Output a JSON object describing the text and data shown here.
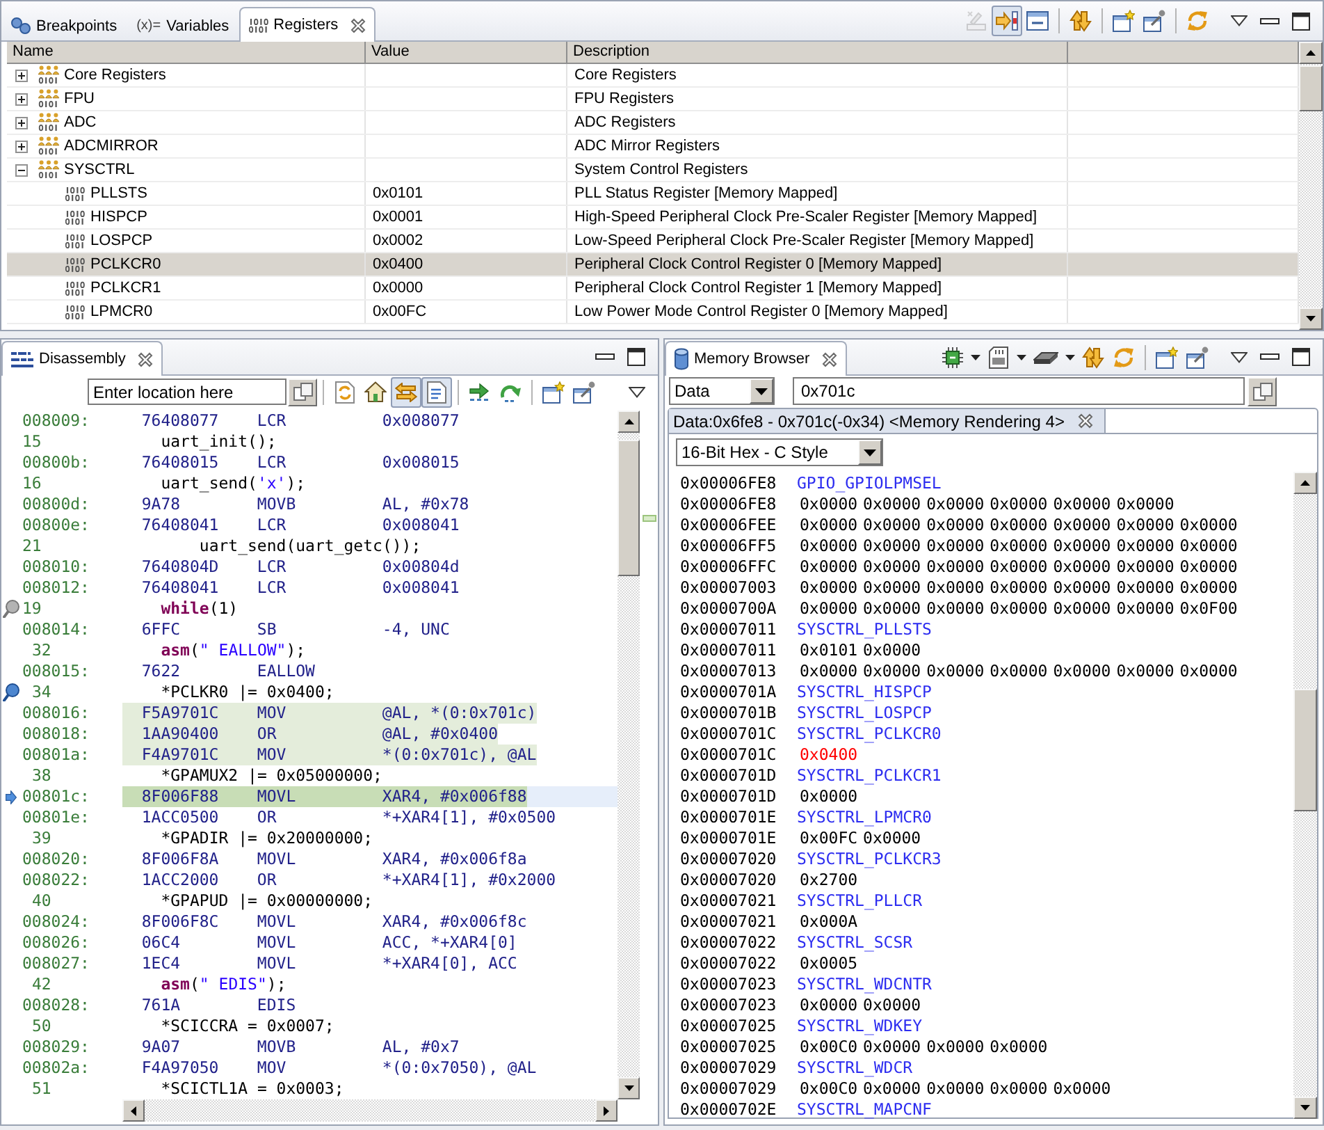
{
  "registers_view": {
    "tabs": [
      {
        "label": "Breakpoints",
        "selected": false
      },
      {
        "label": "Variables",
        "glyph": "(x)=",
        "selected": false
      },
      {
        "label": "Registers",
        "selected": true
      }
    ],
    "toolbar": [
      {
        "pressed": false,
        "disabled": true
      },
      {
        "pressed": true,
        "disabled": false
      },
      {
        "pressed": false,
        "disabled": false
      },
      {
        "pressed": false,
        "disabled": false
      },
      {
        "pressed": false,
        "disabled": false
      },
      {
        "pressed": false,
        "disabled": false
      },
      {
        "pressed": false,
        "disabled": false
      }
    ],
    "table": {
      "columns": [
        "Name",
        "Value",
        "Description"
      ],
      "rows": [
        {
          "kind": "group",
          "name": "Core Registers",
          "description": "Core Registers",
          "expanded": false,
          "selected": false
        },
        {
          "kind": "group",
          "name": "FPU",
          "description": "FPU Registers",
          "expanded": false,
          "selected": false
        },
        {
          "kind": "group",
          "name": "ADC",
          "description": "ADC Registers",
          "expanded": false,
          "selected": false
        },
        {
          "kind": "group",
          "name": "ADCMIRROR",
          "description": "ADC Mirror Registers",
          "expanded": false,
          "selected": false
        },
        {
          "kind": "group",
          "name": "SYSCTRL",
          "description": "System Control Registers",
          "expanded": true,
          "selected": false,
          "children": [
            {
              "kind": "register",
              "name": "PLLSTS",
              "value": "0x0101",
              "description": "PLL Status Register [Memory Mapped]",
              "selected": false
            },
            {
              "kind": "register",
              "name": "HISPCP",
              "value": "0x0001",
              "description": "High-Speed Peripheral Clock Pre-Scaler Register [Memory Mapped]",
              "selected": false
            },
            {
              "kind": "register",
              "name": "LOSPCP",
              "value": "0x0002",
              "description": "Low-Speed Peripheral Clock Pre-Scaler Register [Memory Mapped]",
              "selected": false
            },
            {
              "kind": "register",
              "name": "PCLKCR0",
              "value": "0x0400",
              "description": "Peripheral Clock Control Register 0 [Memory Mapped]",
              "selected": true
            },
            {
              "kind": "register",
              "name": "PCLKCR1",
              "value": "0x0000",
              "description": "Peripheral Clock Control Register 1 [Memory Mapped]",
              "selected": false
            },
            {
              "kind": "register",
              "name": "LPMCR0",
              "value": "0x00FC",
              "description": "Low Power Mode Control Register 0 [Memory Mapped]",
              "selected": false
            }
          ]
        }
      ]
    }
  },
  "disassembly_view": {
    "tabs": [
      {
        "label": "Disassembly",
        "selected": true
      }
    ],
    "location": {
      "placeholder": "Enter location here"
    },
    "toolbar": [
      {
        "pressed": false
      },
      {
        "pressed": false
      },
      {
        "pressed": true
      },
      {
        "pressed": true
      },
      {
        "pressed": false
      },
      {
        "pressed": false
      },
      {
        "pressed": false
      },
      {
        "pressed": false
      }
    ],
    "lines": [
      {
        "kind": "instruction",
        "address": "008009:",
        "opcode": "76408077",
        "mnemonic": "LCR",
        "operands": "0x008077",
        "highlighted": false,
        "current": false
      },
      {
        "kind": "source",
        "line": "15",
        "code": [
          {
            "kind": "plain",
            "text": "  uart_init();"
          }
        ],
        "breakpoint": false
      },
      {
        "kind": "instruction",
        "address": "00800b:",
        "opcode": "76408015",
        "mnemonic": "LCR",
        "operands": "0x008015",
        "highlighted": false,
        "current": false
      },
      {
        "kind": "source",
        "line": "16",
        "code": [
          {
            "kind": "plain",
            "text": "  uart_send("
          },
          {
            "kind": "string",
            "text": "'x'"
          },
          {
            "kind": "plain",
            "text": ");"
          }
        ],
        "breakpoint": false
      },
      {
        "kind": "instruction",
        "address": "00800d:",
        "opcode": "9A78",
        "mnemonic": "MOVB",
        "operands": "AL, #0x78",
        "highlighted": false,
        "current": false
      },
      {
        "kind": "instruction",
        "address": "00800e:",
        "opcode": "76408041",
        "mnemonic": "LCR",
        "operands": "0x008041",
        "highlighted": false,
        "current": false
      },
      {
        "kind": "source",
        "line": "21",
        "code": [
          {
            "kind": "plain",
            "text": "      uart_send(uart_getc());"
          }
        ],
        "breakpoint": false
      },
      {
        "kind": "instruction",
        "address": "008010:",
        "opcode": "7640804D",
        "mnemonic": "LCR",
        "operands": "0x00804d",
        "highlighted": false,
        "current": false
      },
      {
        "kind": "instruction",
        "address": "008012:",
        "opcode": "76408041",
        "mnemonic": "LCR",
        "operands": "0x008041",
        "highlighted": false,
        "current": false
      },
      {
        "kind": "source",
        "line": "19",
        "code": [
          {
            "kind": "keyword",
            "text": "  while"
          },
          {
            "kind": "plain",
            "text": "(1)"
          }
        ],
        "breakpoint": true,
        "breakpoint_enabled": false
      },
      {
        "kind": "instruction",
        "address": "008014:",
        "opcode": "6FFC",
        "mnemonic": "SB",
        "operands": "-4, UNC",
        "highlighted": false,
        "current": false
      },
      {
        "kind": "source",
        "line": " 32",
        "code": [
          {
            "kind": "keyword",
            "text": "  asm"
          },
          {
            "kind": "plain",
            "text": "("
          },
          {
            "kind": "string",
            "text": "\" EALLOW\""
          },
          {
            "kind": "plain",
            "text": ");"
          }
        ],
        "breakpoint": false
      },
      {
        "kind": "instruction",
        "address": "008015:",
        "opcode": "7622",
        "mnemonic": "EALLOW",
        "highlighted": false,
        "current": false
      },
      {
        "kind": "source",
        "line": " 34",
        "code": [
          {
            "kind": "plain",
            "text": "  *PCLKR0 |= 0x0400;"
          }
        ],
        "breakpoint": true,
        "breakpoint_enabled": true
      },
      {
        "kind": "instruction",
        "address": "008016:",
        "opcode": "F5A9701C",
        "mnemonic": "MOV",
        "operands": "@AL, *(0:0x701c)",
        "highlighted": true,
        "current": false
      },
      {
        "kind": "instruction",
        "address": "008018:",
        "opcode": "1AA90400",
        "mnemonic": "OR",
        "operands": "@AL, #0x0400",
        "highlighted": true,
        "current": false
      },
      {
        "kind": "instruction",
        "address": "00801a:",
        "opcode": "F4A9701C",
        "mnemonic": "MOV",
        "operands": "*(0:0x701c), @AL",
        "highlighted": true,
        "current": false
      },
      {
        "kind": "source",
        "line": " 38",
        "code": [
          {
            "kind": "plain",
            "text": "  *GPAMUX2 |= 0x05000000;"
          }
        ],
        "breakpoint": false
      },
      {
        "kind": "instruction",
        "address": "00801c:",
        "opcode": "8F006F88",
        "mnemonic": "MOVL",
        "operands": "XAR4, #0x006f88",
        "highlighted": true,
        "current": true
      },
      {
        "kind": "instruction",
        "address": "00801e:",
        "opcode": "1ACC0500",
        "mnemonic": "OR",
        "operands": "*+XAR4[1], #0x0500",
        "highlighted": false,
        "current": false
      },
      {
        "kind": "source",
        "line": " 39",
        "code": [
          {
            "kind": "plain",
            "text": "  *GPADIR |= 0x20000000;"
          }
        ],
        "breakpoint": false
      },
      {
        "kind": "instruction",
        "address": "008020:",
        "opcode": "8F006F8A",
        "mnemonic": "MOVL",
        "operands": "XAR4, #0x006f8a",
        "highlighted": false,
        "current": false
      },
      {
        "kind": "instruction",
        "address": "008022:",
        "opcode": "1ACC2000",
        "mnemonic": "OR",
        "operands": "*+XAR4[1], #0x2000",
        "highlighted": false,
        "current": false
      },
      {
        "kind": "source",
        "line": " 40",
        "code": [
          {
            "kind": "plain",
            "text": "  *GPAPUD |= 0x00000000;"
          }
        ],
        "breakpoint": false
      },
      {
        "kind": "instruction",
        "address": "008024:",
        "opcode": "8F006F8C",
        "mnemonic": "MOVL",
        "operands": "XAR4, #0x006f8c",
        "highlighted": false,
        "current": false
      },
      {
        "kind": "instruction",
        "address": "008026:",
        "opcode": "06C4",
        "mnemonic": "MOVL",
        "operands": "ACC, *+XAR4[0]",
        "highlighted": false,
        "current": false
      },
      {
        "kind": "instruction",
        "address": "008027:",
        "opcode": "1EC4",
        "mnemonic": "MOVL",
        "operands": "*+XAR4[0], ACC",
        "highlighted": false,
        "current": false
      },
      {
        "kind": "source",
        "line": " 42",
        "code": [
          {
            "kind": "keyword",
            "text": "  asm"
          },
          {
            "kind": "plain",
            "text": "("
          },
          {
            "kind": "string",
            "text": "\" EDIS\""
          },
          {
            "kind": "plain",
            "text": ");"
          }
        ],
        "breakpoint": false
      },
      {
        "kind": "instruction",
        "address": "008028:",
        "opcode": "761A",
        "mnemonic": "EDIS",
        "highlighted": false,
        "current": false
      },
      {
        "kind": "source",
        "line": " 50",
        "code": [
          {
            "kind": "plain",
            "text": "  *SCICCRA = 0x0007;"
          }
        ],
        "breakpoint": false
      },
      {
        "kind": "instruction",
        "address": "008029:",
        "opcode": "9A07",
        "mnemonic": "MOVB",
        "operands": "AL, #0x7",
        "highlighted": false,
        "current": false
      },
      {
        "kind": "instruction",
        "address": "00802a:",
        "opcode": "F4A97050",
        "mnemonic": "MOV",
        "operands": "*(0:0x7050), @AL",
        "highlighted": false,
        "current": false
      },
      {
        "kind": "source",
        "line": " 51",
        "code": [
          {
            "kind": "plain",
            "text": "  *SCICTL1A = 0x0003;"
          }
        ],
        "breakpoint": false
      }
    ]
  },
  "memory_view": {
    "tabs": [
      {
        "label": "Memory Browser",
        "selected": true
      }
    ],
    "memory_space": {
      "value": "Data"
    },
    "address": {
      "value": "0x701c"
    },
    "rendering_tabs": [
      {
        "label": "Data:0x6fe8 - 0x701c(-0x34) <Memory Rendering 4>",
        "selected": true
      }
    ],
    "format": {
      "value": "16-Bit Hex - C Style"
    },
    "lines": [
      {
        "kind": "label",
        "address": "0x00006FE8",
        "label": "GPIO_GPIOLPMSEL"
      },
      {
        "kind": "data",
        "address": "0x00006FE8",
        "values": [
          {
            "text": "0x0000",
            "changed": false
          },
          {
            "text": "0x0000",
            "changed": false
          },
          {
            "text": "0x0000",
            "changed": false
          },
          {
            "text": "0x0000",
            "changed": false
          },
          {
            "text": "0x0000",
            "changed": false
          },
          {
            "text": "0x0000",
            "changed": false
          }
        ]
      },
      {
        "kind": "data",
        "address": "0x00006FEE",
        "values": [
          {
            "text": "0x0000",
            "changed": false
          },
          {
            "text": "0x0000",
            "changed": false
          },
          {
            "text": "0x0000",
            "changed": false
          },
          {
            "text": "0x0000",
            "changed": false
          },
          {
            "text": "0x0000",
            "changed": false
          },
          {
            "text": "0x0000",
            "changed": false
          },
          {
            "text": "0x0000",
            "changed": false
          }
        ]
      },
      {
        "kind": "data",
        "address": "0x00006FF5",
        "values": [
          {
            "text": "0x0000",
            "changed": false
          },
          {
            "text": "0x0000",
            "changed": false
          },
          {
            "text": "0x0000",
            "changed": false
          },
          {
            "text": "0x0000",
            "changed": false
          },
          {
            "text": "0x0000",
            "changed": false
          },
          {
            "text": "0x0000",
            "changed": false
          },
          {
            "text": "0x0000",
            "changed": false
          }
        ]
      },
      {
        "kind": "data",
        "address": "0x00006FFC",
        "values": [
          {
            "text": "0x0000",
            "changed": false
          },
          {
            "text": "0x0000",
            "changed": false
          },
          {
            "text": "0x0000",
            "changed": false
          },
          {
            "text": "0x0000",
            "changed": false
          },
          {
            "text": "0x0000",
            "changed": false
          },
          {
            "text": "0x0000",
            "changed": false
          },
          {
            "text": "0x0000",
            "changed": false
          }
        ]
      },
      {
        "kind": "data",
        "address": "0x00007003",
        "values": [
          {
            "text": "0x0000",
            "changed": false
          },
          {
            "text": "0x0000",
            "changed": false
          },
          {
            "text": "0x0000",
            "changed": false
          },
          {
            "text": "0x0000",
            "changed": false
          },
          {
            "text": "0x0000",
            "changed": false
          },
          {
            "text": "0x0000",
            "changed": false
          },
          {
            "text": "0x0000",
            "changed": false
          }
        ]
      },
      {
        "kind": "data",
        "address": "0x0000700A",
        "values": [
          {
            "text": "0x0000",
            "changed": false
          },
          {
            "text": "0x0000",
            "changed": false
          },
          {
            "text": "0x0000",
            "changed": false
          },
          {
            "text": "0x0000",
            "changed": false
          },
          {
            "text": "0x0000",
            "changed": false
          },
          {
            "text": "0x0000",
            "changed": false
          },
          {
            "text": "0x0F00",
            "changed": false
          }
        ]
      },
      {
        "kind": "label",
        "address": "0x00007011",
        "label": "SYSCTRL_PLLSTS"
      },
      {
        "kind": "data",
        "address": "0x00007011",
        "values": [
          {
            "text": "0x0101",
            "changed": false
          },
          {
            "text": "0x0000",
            "changed": false
          }
        ]
      },
      {
        "kind": "data",
        "address": "0x00007013",
        "values": [
          {
            "text": "0x0000",
            "changed": false
          },
          {
            "text": "0x0000",
            "changed": false
          },
          {
            "text": "0x0000",
            "changed": false
          },
          {
            "text": "0x0000",
            "changed": false
          },
          {
            "text": "0x0000",
            "changed": false
          },
          {
            "text": "0x0000",
            "changed": false
          },
          {
            "text": "0x0000",
            "changed": false
          }
        ]
      },
      {
        "kind": "label",
        "address": "0x0000701A",
        "label": "SYSCTRL_HISPCP"
      },
      {
        "kind": "label",
        "address": "0x0000701B",
        "label": "SYSCTRL_LOSPCP"
      },
      {
        "kind": "label",
        "address": "0x0000701C",
        "label": "SYSCTRL_PCLKCR0"
      },
      {
        "kind": "data",
        "address": "0x0000701C",
        "values": [
          {
            "text": "0x0400",
            "changed": true
          }
        ]
      },
      {
        "kind": "label",
        "address": "0x0000701D",
        "label": "SYSCTRL_PCLKCR1"
      },
      {
        "kind": "data",
        "address": "0x0000701D",
        "values": [
          {
            "text": "0x0000",
            "changed": false
          }
        ]
      },
      {
        "kind": "label",
        "address": "0x0000701E",
        "label": "SYSCTRL_LPMCR0"
      },
      {
        "kind": "data",
        "address": "0x0000701E",
        "values": [
          {
            "text": "0x00FC",
            "changed": false
          },
          {
            "text": "0x0000",
            "changed": false
          }
        ]
      },
      {
        "kind": "label",
        "address": "0x00007020",
        "label": "SYSCTRL_PCLKCR3"
      },
      {
        "kind": "data",
        "address": "0x00007020",
        "values": [
          {
            "text": "0x2700",
            "changed": false
          }
        ]
      },
      {
        "kind": "label",
        "address": "0x00007021",
        "label": "SYSCTRL_PLLCR"
      },
      {
        "kind": "data",
        "address": "0x00007021",
        "values": [
          {
            "text": "0x000A",
            "changed": false
          }
        ]
      },
      {
        "kind": "label",
        "address": "0x00007022",
        "label": "SYSCTRL_SCSR"
      },
      {
        "kind": "data",
        "address": "0x00007022",
        "values": [
          {
            "text": "0x0005",
            "changed": false
          }
        ]
      },
      {
        "kind": "label",
        "address": "0x00007023",
        "label": "SYSCTRL_WDCNTR"
      },
      {
        "kind": "data",
        "address": "0x00007023",
        "values": [
          {
            "text": "0x0000",
            "changed": false
          },
          {
            "text": "0x0000",
            "changed": false
          }
        ]
      },
      {
        "kind": "label",
        "address": "0x00007025",
        "label": "SYSCTRL_WDKEY"
      },
      {
        "kind": "data",
        "address": "0x00007025",
        "values": [
          {
            "text": "0x00C0",
            "changed": false
          },
          {
            "text": "0x0000",
            "changed": false
          },
          {
            "text": "0x0000",
            "changed": false
          },
          {
            "text": "0x0000",
            "changed": false
          }
        ]
      },
      {
        "kind": "label",
        "address": "0x00007029",
        "label": "SYSCTRL_WDCR"
      },
      {
        "kind": "data",
        "address": "0x00007029",
        "values": [
          {
            "text": "0x00C0",
            "changed": false
          },
          {
            "text": "0x0000",
            "changed": false
          },
          {
            "text": "0x0000",
            "changed": false
          },
          {
            "text": "0x0000",
            "changed": false
          },
          {
            "text": "0x0000",
            "changed": false
          }
        ]
      },
      {
        "kind": "label",
        "address": "0x0000702E",
        "label": "SYSCTRL_MAPCNF"
      }
    ]
  }
}
